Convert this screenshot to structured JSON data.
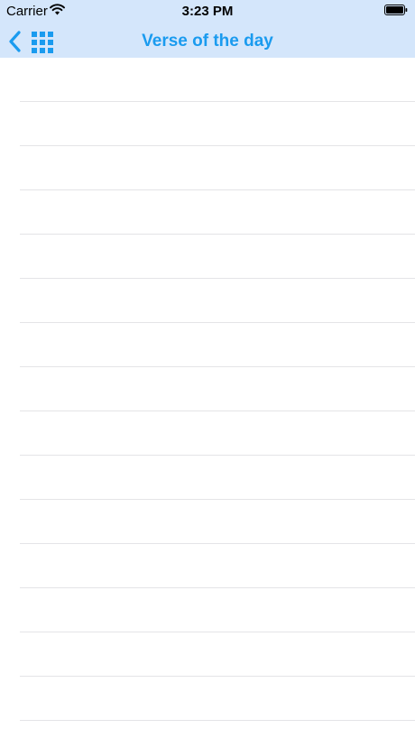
{
  "status_bar": {
    "carrier": "Carrier",
    "time": "3:23 PM"
  },
  "navbar": {
    "title": "Verse of the day"
  },
  "icons": {
    "back": "chevron-left-icon",
    "grid": "grid-icon",
    "wifi": "wifi-icon",
    "battery": "battery-icon"
  },
  "colors": {
    "navbar_background": "#d4e6fb",
    "accent": "#1a9bef",
    "separator": "#e4e4e7"
  }
}
